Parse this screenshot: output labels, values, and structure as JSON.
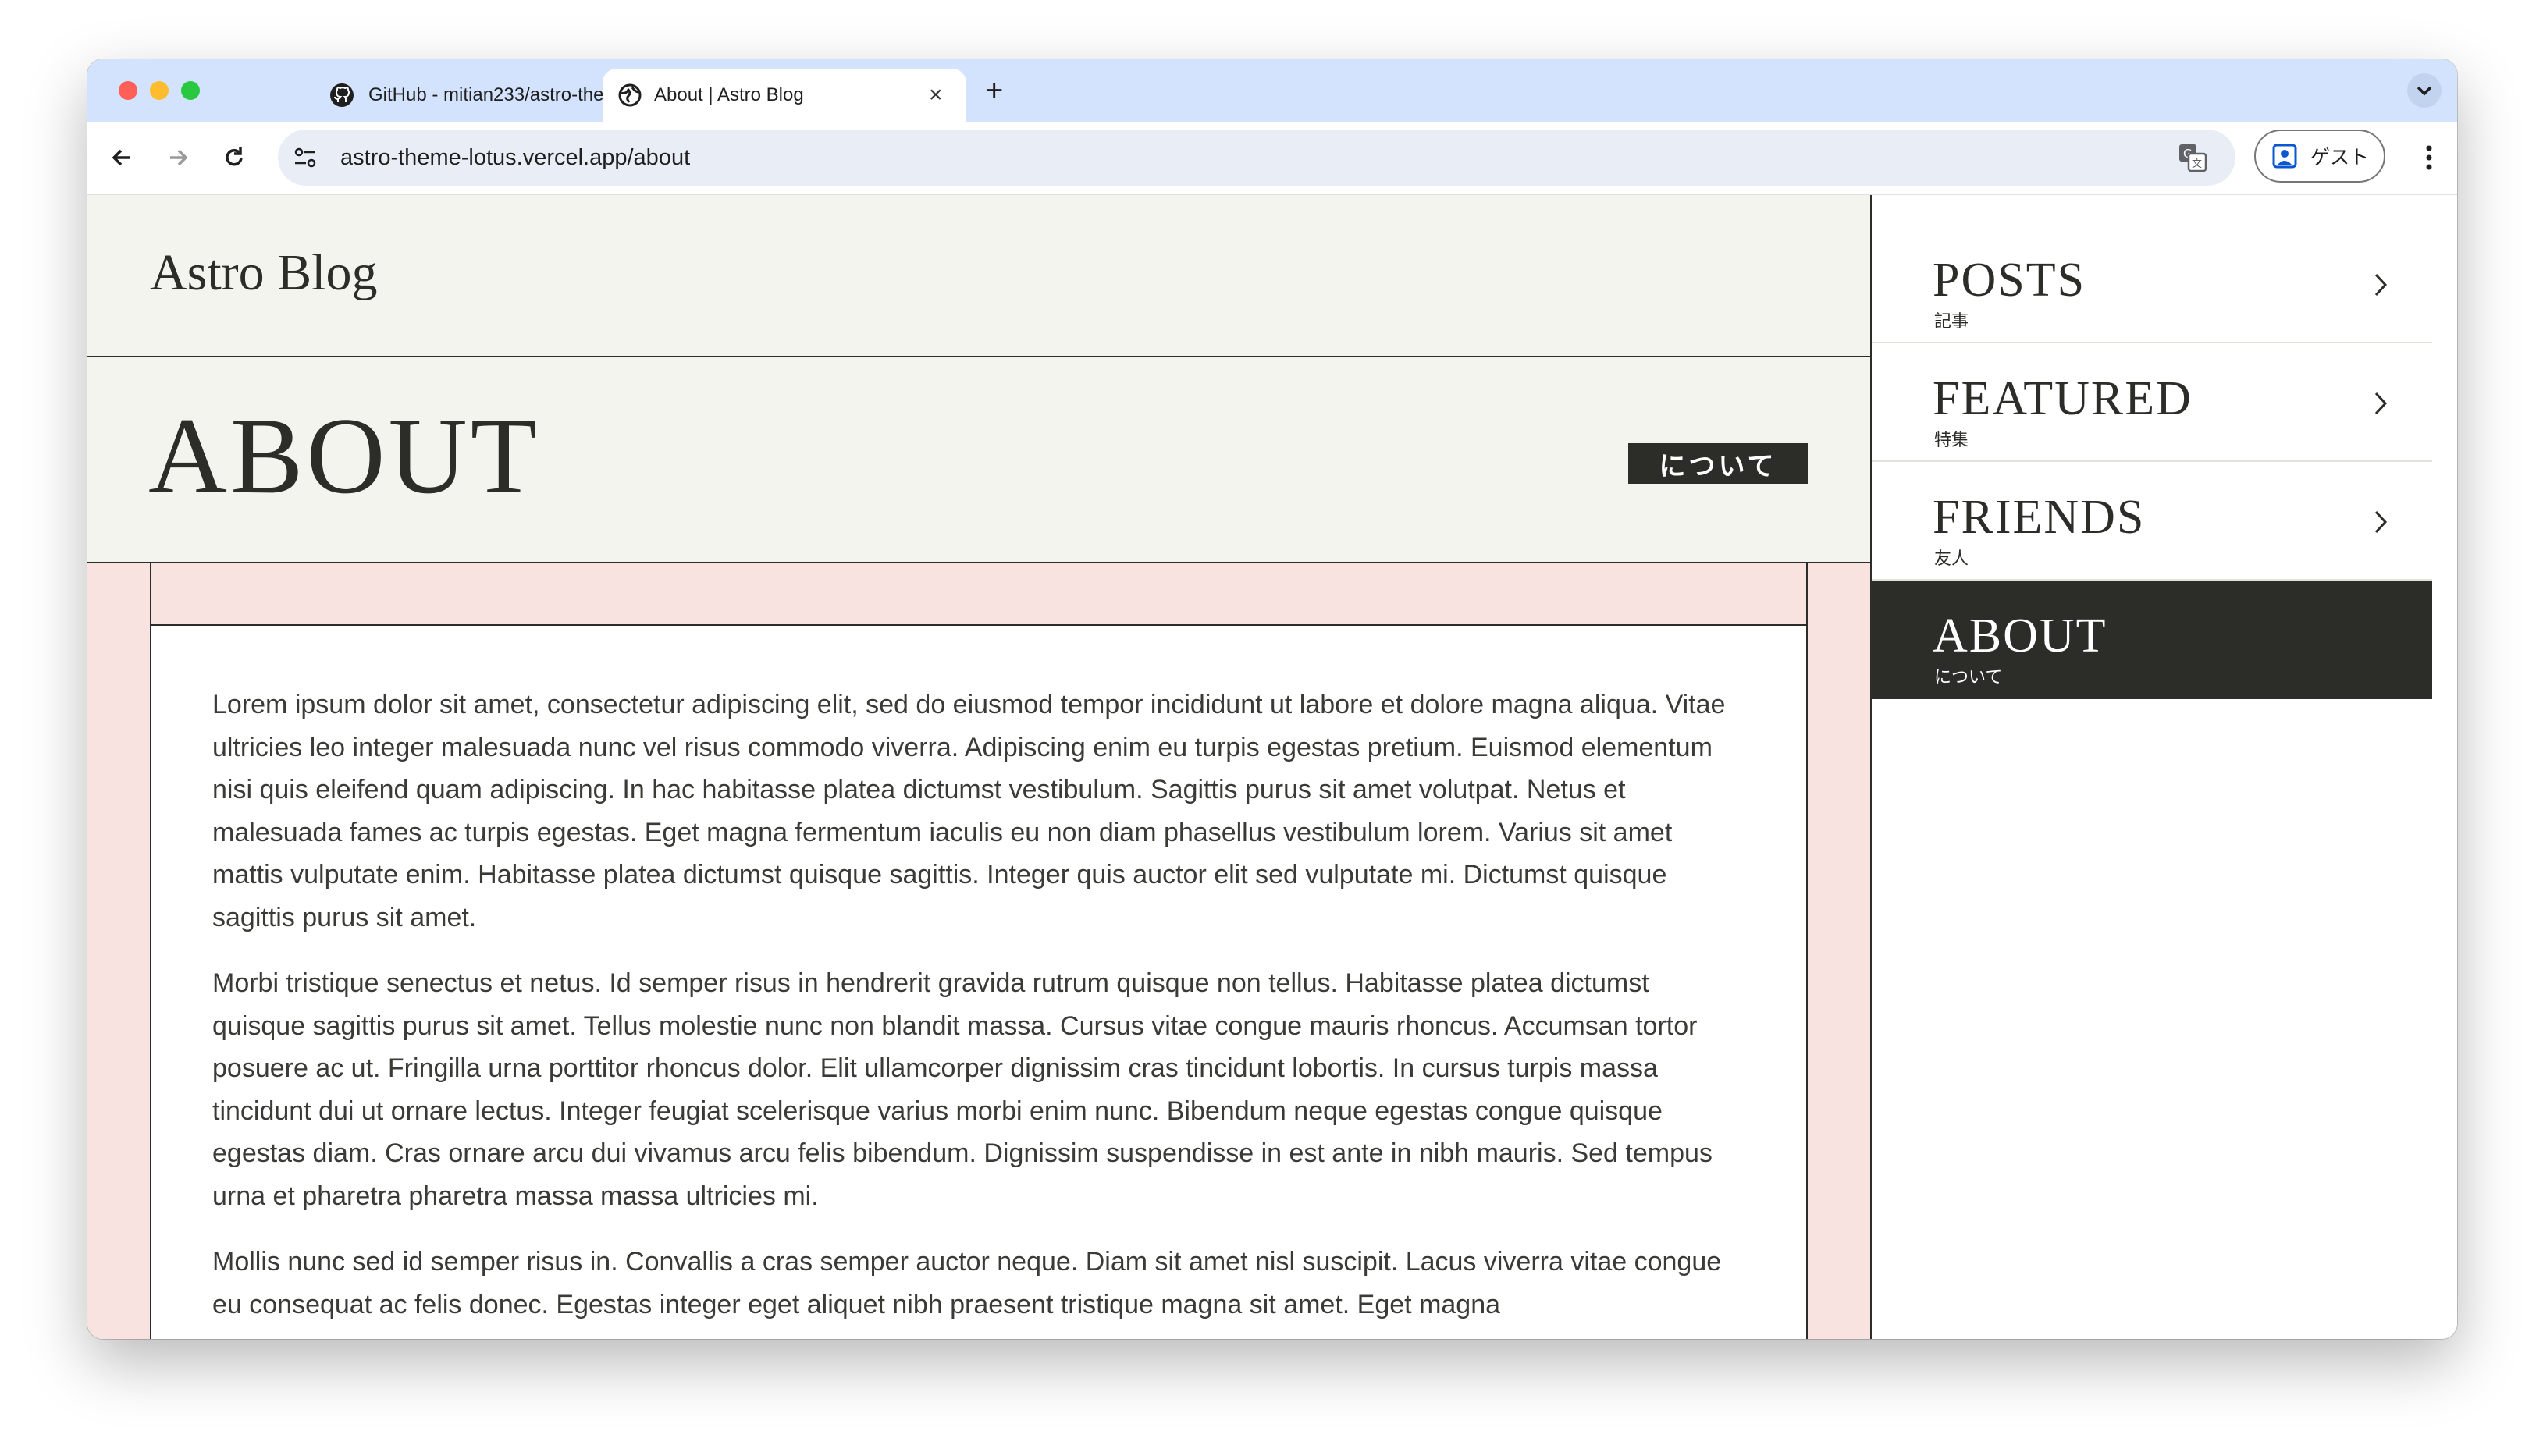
{
  "browser": {
    "tabs": [
      {
        "title": "GitHub - mitian233/astro-the",
        "icon": "github-icon"
      },
      {
        "title": "About | Astro Blog",
        "icon": "globe-icon"
      }
    ],
    "new_tab_label": "+",
    "url": "astro-theme-lotus.vercel.app/about",
    "profile_label": "ゲスト",
    "colors": {
      "tabbar": "#d3e3fd",
      "close": "#ff5f57",
      "minimize": "#febc2e",
      "maximize": "#28c840"
    }
  },
  "site": {
    "logo": "Astro Blog"
  },
  "hero": {
    "title": "ABOUT",
    "badge": "について"
  },
  "article": {
    "paragraphs": [
      "Lorem ipsum dolor sit amet, consectetur adipiscing elit, sed do eiusmod tempor incididunt ut labore et dolore magna aliqua. Vitae ultricies leo integer malesuada nunc vel risus commodo viverra. Adipiscing enim eu turpis egestas pretium. Euismod elementum nisi quis eleifend quam adipiscing. In hac habitasse platea dictumst vestibulum. Sagittis purus sit amet volutpat. Netus et malesuada fames ac turpis egestas. Eget magna fermentum iaculis eu non diam phasellus vestibulum lorem. Varius sit amet mattis vulputate enim. Habitasse platea dictumst quisque sagittis. Integer quis auctor elit sed vulputate mi. Dictumst quisque sagittis purus sit amet.",
      "Morbi tristique senectus et netus. Id semper risus in hendrerit gravida rutrum quisque non tellus. Habitasse platea dictumst quisque sagittis purus sit amet. Tellus molestie nunc non blandit massa. Cursus vitae congue mauris rhoncus. Accumsan tortor posuere ac ut. Fringilla urna porttitor rhoncus dolor. Elit ullamcorper dignissim cras tincidunt lobortis. In cursus turpis massa tincidunt dui ut ornare lectus. Integer feugiat scelerisque varius morbi enim nunc. Bibendum neque egestas congue quisque egestas diam. Cras ornare arcu dui vivamus arcu felis bibendum. Dignissim suspendisse in est ante in nibh mauris. Sed tempus urna et pharetra pharetra massa massa ultricies mi.",
      "Mollis nunc sed id semper risus in. Convallis a cras semper auctor neque. Diam sit amet nisl suscipit. Lacus viverra vitae congue eu consequat ac felis donec. Egestas integer eget aliquet nibh praesent tristique magna sit amet. Eget magna"
    ]
  },
  "nav": {
    "items": [
      {
        "en": "POSTS",
        "ja": "記事",
        "active": false
      },
      {
        "en": "FEATURED",
        "ja": "特集",
        "active": false
      },
      {
        "en": "FRIENDS",
        "ja": "友人",
        "active": false
      },
      {
        "en": "ABOUT",
        "ja": "について",
        "active": true
      }
    ]
  }
}
